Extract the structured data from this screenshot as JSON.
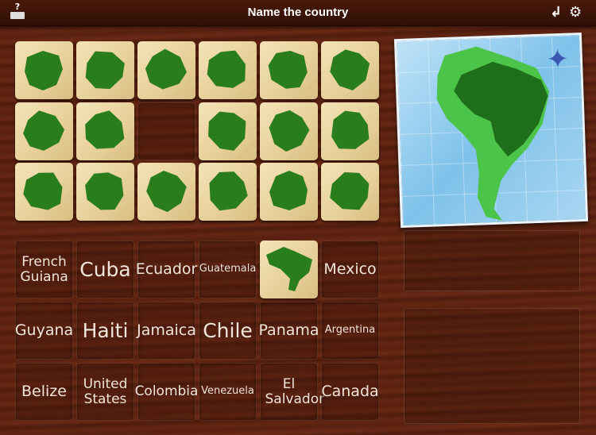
{
  "header": {
    "title": "Name the country",
    "help_label": "?"
  },
  "colors": {
    "shape": "#2a7d1c",
    "map_continent": "#4cc44a",
    "map_highlight": "#1e6e1a"
  },
  "shape_tiles": [
    [
      "united-states",
      "venezuela",
      "guyana",
      "guatemala",
      "cuba",
      "chile-shape"
    ],
    [
      "ecuador",
      "haiti",
      null,
      "chile",
      "panama",
      "mexico"
    ],
    [
      "french-guiana",
      "jamaica",
      "colombia",
      "canada",
      "belize",
      "argentina"
    ]
  ],
  "name_rows": [
    [
      "French Guiana",
      "Cuba",
      "Ecuador",
      "Guatemala",
      null,
      "Mexico"
    ],
    [
      "Guyana",
      "Haiti",
      "Jamaica",
      "Chile",
      "Panama",
      "Argentina"
    ],
    [
      "Belize",
      "United States",
      "Colombia",
      "Venezuela",
      "El Salvador",
      "Canada"
    ]
  ],
  "placed_tile": "brazil"
}
